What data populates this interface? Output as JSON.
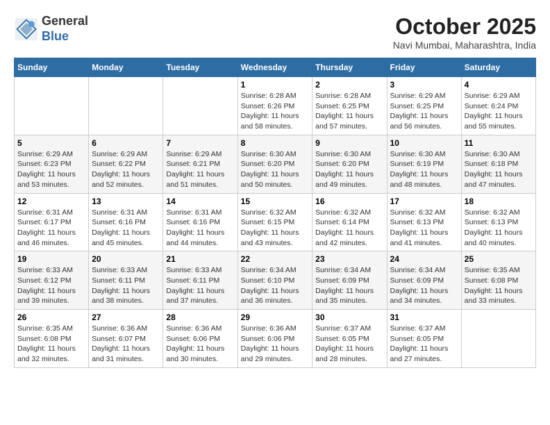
{
  "header": {
    "logo_general": "General",
    "logo_blue": "Blue",
    "month": "October 2025",
    "location": "Navi Mumbai, Maharashtra, India"
  },
  "days_of_week": [
    "Sunday",
    "Monday",
    "Tuesday",
    "Wednesday",
    "Thursday",
    "Friday",
    "Saturday"
  ],
  "weeks": [
    [
      {
        "day": "",
        "info": ""
      },
      {
        "day": "",
        "info": ""
      },
      {
        "day": "",
        "info": ""
      },
      {
        "day": "1",
        "info": "Sunrise: 6:28 AM\nSunset: 6:26 PM\nDaylight: 11 hours\nand 58 minutes."
      },
      {
        "day": "2",
        "info": "Sunrise: 6:28 AM\nSunset: 6:25 PM\nDaylight: 11 hours\nand 57 minutes."
      },
      {
        "day": "3",
        "info": "Sunrise: 6:29 AM\nSunset: 6:25 PM\nDaylight: 11 hours\nand 56 minutes."
      },
      {
        "day": "4",
        "info": "Sunrise: 6:29 AM\nSunset: 6:24 PM\nDaylight: 11 hours\nand 55 minutes."
      }
    ],
    [
      {
        "day": "5",
        "info": "Sunrise: 6:29 AM\nSunset: 6:23 PM\nDaylight: 11 hours\nand 53 minutes."
      },
      {
        "day": "6",
        "info": "Sunrise: 6:29 AM\nSunset: 6:22 PM\nDaylight: 11 hours\nand 52 minutes."
      },
      {
        "day": "7",
        "info": "Sunrise: 6:29 AM\nSunset: 6:21 PM\nDaylight: 11 hours\nand 51 minutes."
      },
      {
        "day": "8",
        "info": "Sunrise: 6:30 AM\nSunset: 6:20 PM\nDaylight: 11 hours\nand 50 minutes."
      },
      {
        "day": "9",
        "info": "Sunrise: 6:30 AM\nSunset: 6:20 PM\nDaylight: 11 hours\nand 49 minutes."
      },
      {
        "day": "10",
        "info": "Sunrise: 6:30 AM\nSunset: 6:19 PM\nDaylight: 11 hours\nand 48 minutes."
      },
      {
        "day": "11",
        "info": "Sunrise: 6:30 AM\nSunset: 6:18 PM\nDaylight: 11 hours\nand 47 minutes."
      }
    ],
    [
      {
        "day": "12",
        "info": "Sunrise: 6:31 AM\nSunset: 6:17 PM\nDaylight: 11 hours\nand 46 minutes."
      },
      {
        "day": "13",
        "info": "Sunrise: 6:31 AM\nSunset: 6:16 PM\nDaylight: 11 hours\nand 45 minutes."
      },
      {
        "day": "14",
        "info": "Sunrise: 6:31 AM\nSunset: 6:16 PM\nDaylight: 11 hours\nand 44 minutes."
      },
      {
        "day": "15",
        "info": "Sunrise: 6:32 AM\nSunset: 6:15 PM\nDaylight: 11 hours\nand 43 minutes."
      },
      {
        "day": "16",
        "info": "Sunrise: 6:32 AM\nSunset: 6:14 PM\nDaylight: 11 hours\nand 42 minutes."
      },
      {
        "day": "17",
        "info": "Sunrise: 6:32 AM\nSunset: 6:13 PM\nDaylight: 11 hours\nand 41 minutes."
      },
      {
        "day": "18",
        "info": "Sunrise: 6:32 AM\nSunset: 6:13 PM\nDaylight: 11 hours\nand 40 minutes."
      }
    ],
    [
      {
        "day": "19",
        "info": "Sunrise: 6:33 AM\nSunset: 6:12 PM\nDaylight: 11 hours\nand 39 minutes."
      },
      {
        "day": "20",
        "info": "Sunrise: 6:33 AM\nSunset: 6:11 PM\nDaylight: 11 hours\nand 38 minutes."
      },
      {
        "day": "21",
        "info": "Sunrise: 6:33 AM\nSunset: 6:11 PM\nDaylight: 11 hours\nand 37 minutes."
      },
      {
        "day": "22",
        "info": "Sunrise: 6:34 AM\nSunset: 6:10 PM\nDaylight: 11 hours\nand 36 minutes."
      },
      {
        "day": "23",
        "info": "Sunrise: 6:34 AM\nSunset: 6:09 PM\nDaylight: 11 hours\nand 35 minutes."
      },
      {
        "day": "24",
        "info": "Sunrise: 6:34 AM\nSunset: 6:09 PM\nDaylight: 11 hours\nand 34 minutes."
      },
      {
        "day": "25",
        "info": "Sunrise: 6:35 AM\nSunset: 6:08 PM\nDaylight: 11 hours\nand 33 minutes."
      }
    ],
    [
      {
        "day": "26",
        "info": "Sunrise: 6:35 AM\nSunset: 6:08 PM\nDaylight: 11 hours\nand 32 minutes."
      },
      {
        "day": "27",
        "info": "Sunrise: 6:36 AM\nSunset: 6:07 PM\nDaylight: 11 hours\nand 31 minutes."
      },
      {
        "day": "28",
        "info": "Sunrise: 6:36 AM\nSunset: 6:06 PM\nDaylight: 11 hours\nand 30 minutes."
      },
      {
        "day": "29",
        "info": "Sunrise: 6:36 AM\nSunset: 6:06 PM\nDaylight: 11 hours\nand 29 minutes."
      },
      {
        "day": "30",
        "info": "Sunrise: 6:37 AM\nSunset: 6:05 PM\nDaylight: 11 hours\nand 28 minutes."
      },
      {
        "day": "31",
        "info": "Sunrise: 6:37 AM\nSunset: 6:05 PM\nDaylight: 11 hours\nand 27 minutes."
      },
      {
        "day": "",
        "info": ""
      }
    ]
  ]
}
